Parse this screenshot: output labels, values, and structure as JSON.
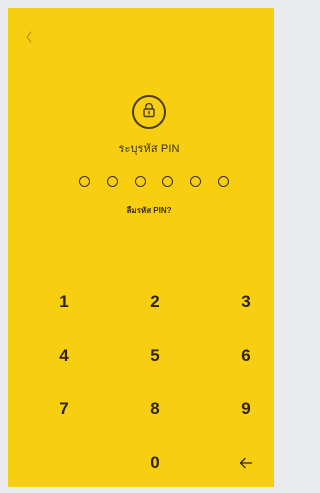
{
  "screen": {
    "background": "#f7cf10",
    "foreground": "#3d2f12"
  },
  "header": {
    "back_icon": "chevron-left-icon"
  },
  "pin": {
    "lock_icon": "lock-icon",
    "title": "ระบุรหัส PIN",
    "dots_count": 6,
    "forgot_label": "ลืมรหัส PIN?"
  },
  "keypad": {
    "keys": [
      "1",
      "2",
      "3",
      "4",
      "5",
      "6",
      "7",
      "8",
      "9",
      "0"
    ],
    "backspace_icon": "arrow-left-icon"
  }
}
